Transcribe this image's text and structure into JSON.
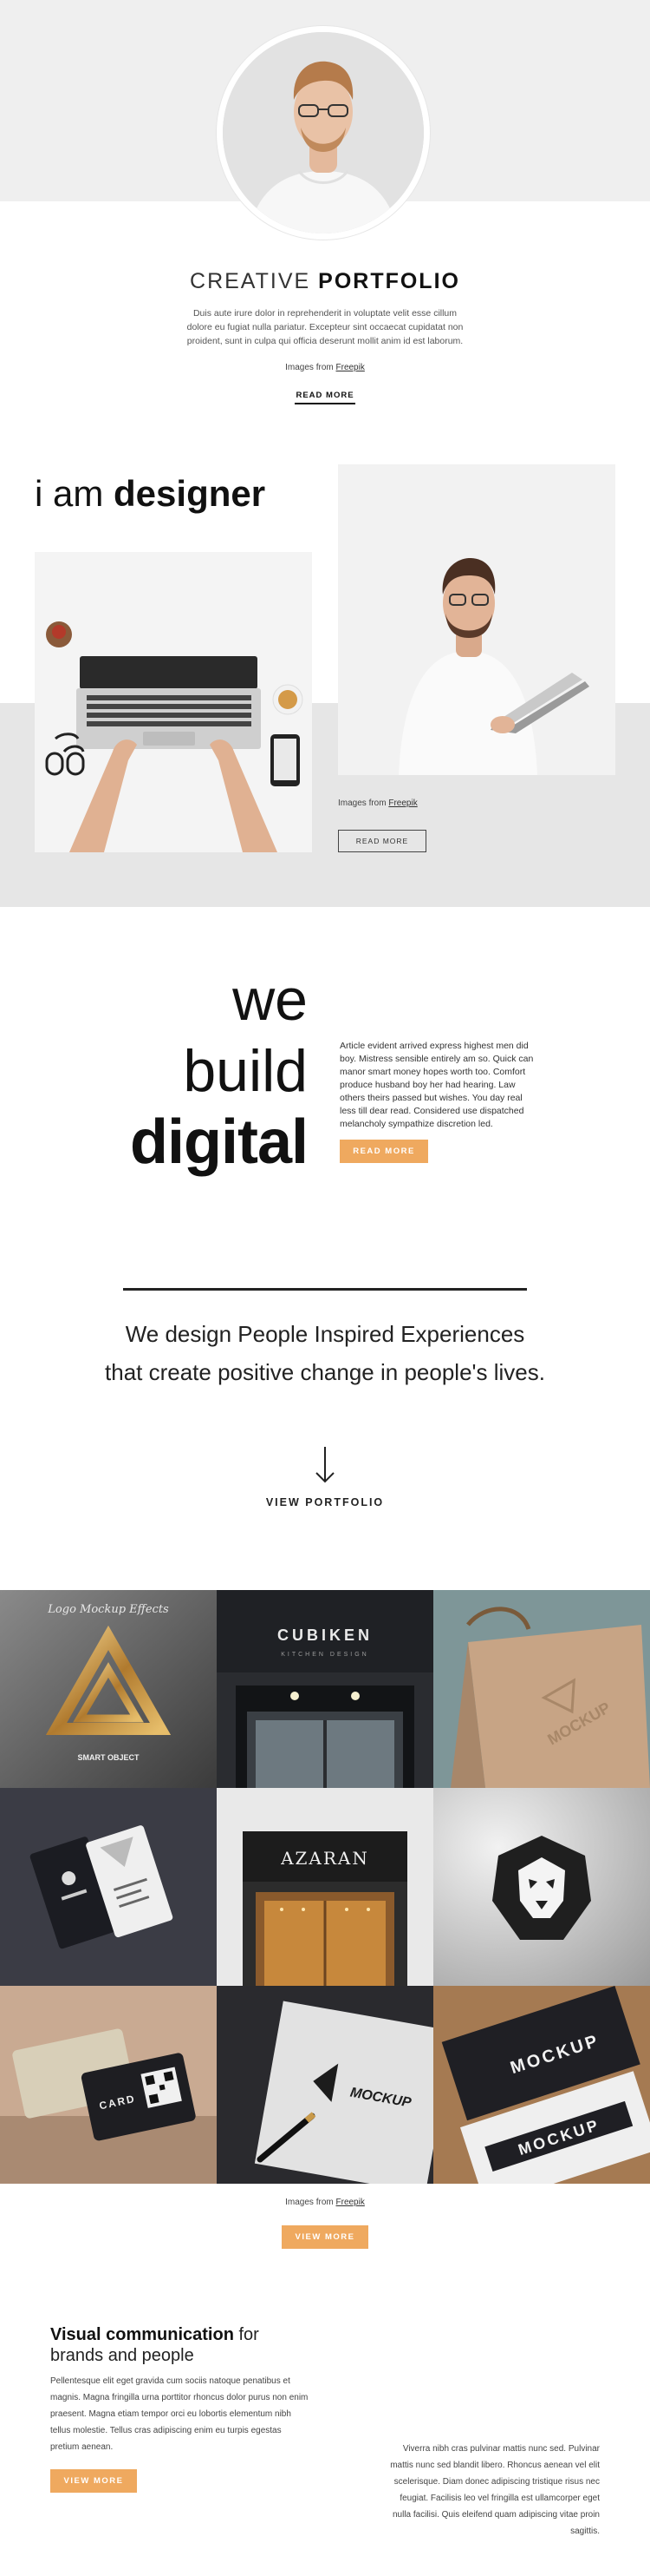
{
  "hero": {
    "title_light": "CREATIVE",
    "title_bold": "PORTFOLIO",
    "text": "Duis aute irure dolor in reprehenderit in voluptate velit esse cillum dolore eu fugiat nulla pariatur. Excepteur sint occaecat cupidatat non proident, sunt in culpa qui officia deserunt mollit anim id est laborum.",
    "credit_prefix": "Images from",
    "credit_link": "Freepik",
    "read_more": "READ MORE"
  },
  "designer": {
    "title_light": "i am",
    "title_bold": "designer",
    "credit_prefix": "Images from",
    "credit_link": "Freepik",
    "read_more": "READ MORE"
  },
  "build": {
    "line1": "we",
    "line2": "build",
    "line3": "digital",
    "text": "Article evident arrived express highest men did boy. Mistress sensible entirely am so. Quick can manor smart money hopes worth too. Comfort produce husband boy her had hearing. Law others theirs passed but wishes. You day real less till dear read. Considered use dispatched melancholy sympathize discretion led.",
    "button": "READ MORE"
  },
  "mission": {
    "text": "We design People Inspired Experiences that create positive change in people's lives.",
    "link": "VIEW PORTFOLIO",
    "arrow_icon": "arrow-down-icon"
  },
  "gallery": {
    "tiles": [
      {
        "icon": "triangle-logo-mockup",
        "caption": "Logo Mockup Effects",
        "sub": "SMART OBJECT"
      },
      {
        "icon": "storefront-sign-mockup",
        "caption": "CUBIKEN",
        "sub": "KITCHEN DESIGN"
      },
      {
        "icon": "paper-bag-mockup",
        "caption": "MOCKUP"
      },
      {
        "icon": "business-card-mockup"
      },
      {
        "icon": "azaran-storefront-mockup",
        "caption": "AZARAN"
      },
      {
        "icon": "lion-emblem-mockup"
      },
      {
        "icon": "qr-card-mockup",
        "caption": "CARD"
      },
      {
        "icon": "paper-logo-mockup",
        "caption": "MOCKUP"
      },
      {
        "icon": "stacked-cards-mockup",
        "caption": "MOCKUP",
        "sub": "MOCKUP"
      }
    ],
    "credit_prefix": "Images from",
    "credit_link": "Freepik",
    "button": "VIEW MORE"
  },
  "visual": {
    "title_bold": "Visual communication",
    "title_rest": "for",
    "title_line2": "brands and people",
    "text": "Pellentesque elit eget gravida cum sociis natoque penatibus et magnis. Magna fringilla urna porttitor rhoncus dolor purus non enim praesent. Magna etiam tempor orci eu lobortis elementum nibh tellus molestie. Tellus cras adipiscing enim eu turpis egestas pretium aenean.",
    "button": "VIEW MORE",
    "right_text": "Viverra nibh cras pulvinar mattis nunc sed. Pulvinar mattis nunc sed blandit libero. Rhoncus aenean vel elit scelerisque. Diam donec adipiscing tristique risus nec feugiat. Facilisis leo vel fringilla est ullamcorper eget nulla facilisi. Quis eleifend quam adipiscing vitae proin sagittis."
  },
  "colors": {
    "accent": "#efa95f",
    "band": "#efefef",
    "dark": "#111111"
  }
}
